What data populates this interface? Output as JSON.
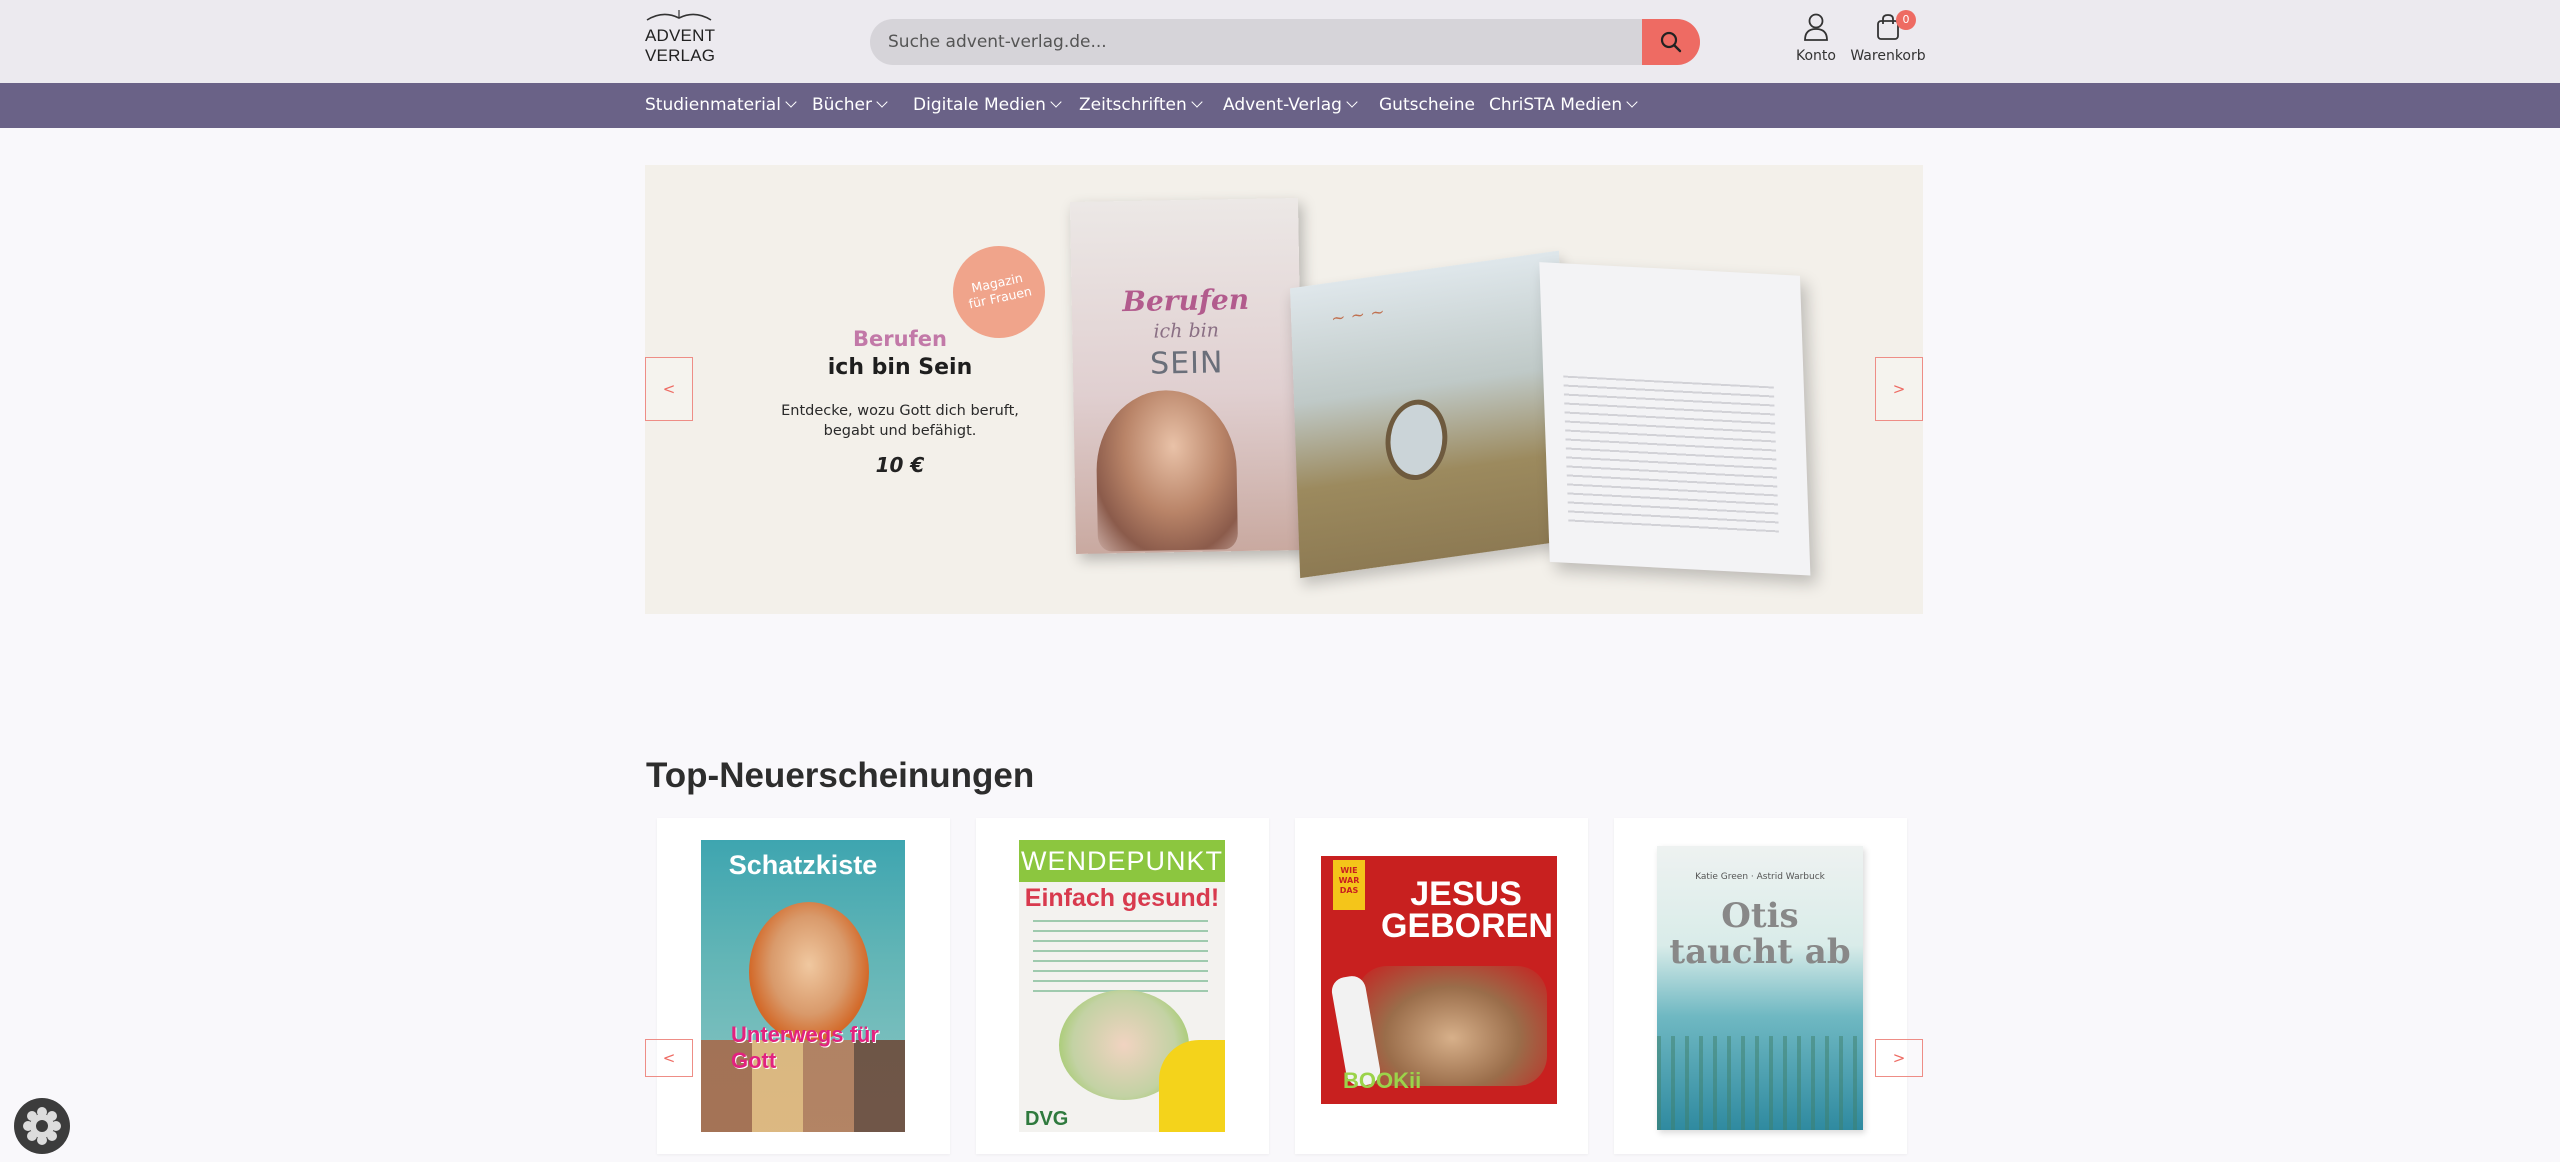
{
  "logo": {
    "line1": "ADVENT",
    "line2": "VERLAG"
  },
  "search": {
    "placeholder": "Suche advent-verlag.de..."
  },
  "header": {
    "account_label": "Konto",
    "cart_label": "Warenkorb",
    "cart_count": "0"
  },
  "nav": {
    "items": [
      {
        "label": "Studienmaterial"
      },
      {
        "label": "Bücher"
      },
      {
        "label": "Digitale Medien"
      },
      {
        "label": "Zeitschriften"
      },
      {
        "label": "Advent-Verlag"
      },
      {
        "label": "Gutscheine"
      },
      {
        "label": "ChriSTA Medien"
      }
    ]
  },
  "hero": {
    "badge_line1": "Magazin",
    "badge_line2": "für Frauen",
    "title_accent": "Berufen",
    "title": "ich bin Sein",
    "text_line1": "Entdecke, wozu Gott dich beruft,",
    "text_line2": "begabt und befähigt.",
    "price": "10 €",
    "cover_title1": "Berufen",
    "cover_title2": "ich bin",
    "cover_title3": "SEIN",
    "prev": "<",
    "next": ">"
  },
  "products": {
    "title": "Top-Neuerscheinungen",
    "prev": "<",
    "next": ">",
    "items": [
      {
        "cover_title": "Schatzkiste",
        "cover_sub": "Unterwegs für Gott"
      },
      {
        "cover_band": "WENDEPUNKT",
        "cover_title": "Einfach gesund!",
        "cover_logo": "DVG"
      },
      {
        "cover_title": "JESUS GEBOREN",
        "cover_tag": "WIE WAR DAS",
        "cover_logo": "BOOKii"
      },
      {
        "cover_author": "Katie Green · Astrid Warbuck",
        "cover_title": "Otis taucht ab"
      }
    ]
  },
  "colors": {
    "accent": "#ee6b63",
    "nav_bg": "#6a6287",
    "header_bg": "#eceaef",
    "hero_bg": "#f3f0ea"
  }
}
